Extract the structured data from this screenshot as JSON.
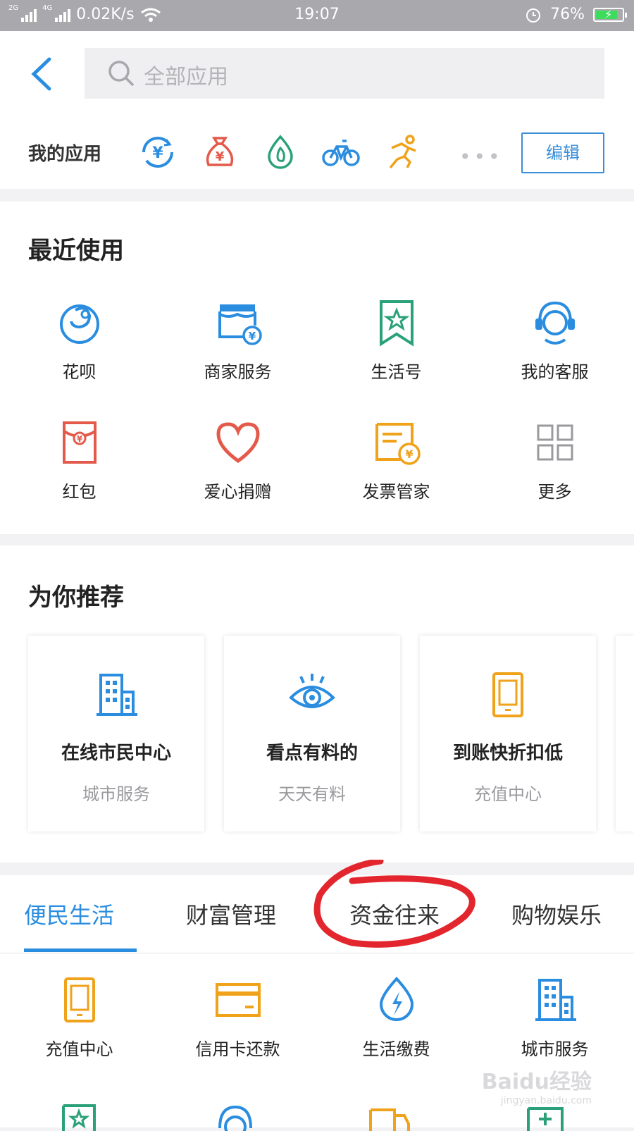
{
  "status": {
    "signal_a": "2G",
    "signal_b": "4G",
    "speed": "0.02K/s",
    "time": "19:07",
    "battery": "76%"
  },
  "search": {
    "placeholder": "全部应用"
  },
  "my_apps": {
    "title": "我的应用",
    "icons": [
      "yuan-exchange-icon",
      "money-bag-icon",
      "drop-icon",
      "bicycle-icon",
      "running-icon"
    ],
    "more": "•••",
    "edit": "编辑"
  },
  "recent": {
    "title": "最近使用",
    "items": [
      {
        "label": "花呗",
        "icon": "huabei-icon"
      },
      {
        "label": "商家服务",
        "icon": "shop-icon"
      },
      {
        "label": "生活号",
        "icon": "bookmark-star-icon"
      },
      {
        "label": "我的客服",
        "icon": "headset-icon"
      },
      {
        "label": "红包",
        "icon": "red-envelope-icon"
      },
      {
        "label": "爱心捐赠",
        "icon": "heart-icon"
      },
      {
        "label": "发票管家",
        "icon": "invoice-icon"
      },
      {
        "label": "更多",
        "icon": "grid-icon"
      }
    ]
  },
  "recommend": {
    "title": "为你推荐",
    "cards": [
      {
        "title": "在线市民中心",
        "subtitle": "城市服务",
        "icon": "building-icon"
      },
      {
        "title": "看点有料的",
        "subtitle": "天天有料",
        "icon": "eye-icon"
      },
      {
        "title": "到账快折扣低",
        "subtitle": "充值中心",
        "icon": "phone-icon"
      }
    ]
  },
  "tabs": [
    "便民生活",
    "财富管理",
    "资金往来",
    "购物娱乐"
  ],
  "life": {
    "items": [
      {
        "label": "充值中心",
        "icon": "phone-icon"
      },
      {
        "label": "信用卡还款",
        "icon": "card-icon"
      },
      {
        "label": "生活缴费",
        "icon": "bolt-drop-icon"
      },
      {
        "label": "城市服务",
        "icon": "building-icon"
      }
    ]
  },
  "watermark": {
    "brand": "Baidu经验",
    "url": "jingyan.baidu.com"
  }
}
